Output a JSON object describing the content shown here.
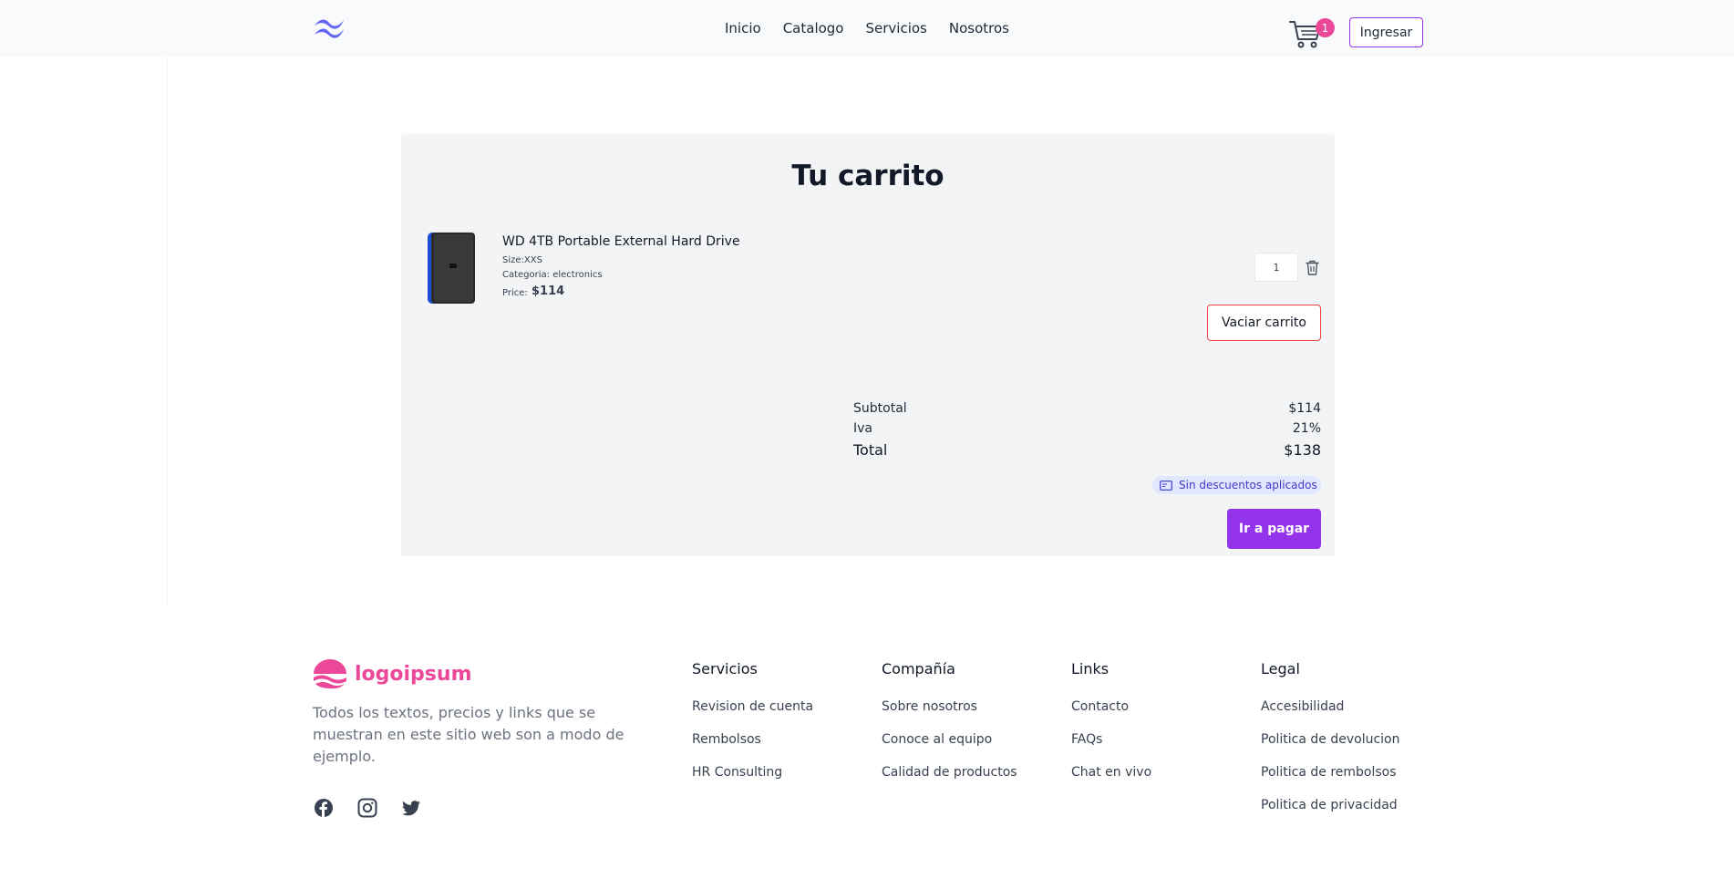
{
  "header": {
    "brand_icon": "tailwind-logo",
    "nav": [
      "Inicio",
      "Catalogo",
      "Servicios",
      "Nosotros"
    ],
    "cart_count": "1",
    "login_label": "Ingresar"
  },
  "cart": {
    "title": "Tu carrito",
    "item": {
      "name": "WD 4TB Portable External Hard Drive",
      "size": "Size:XXS",
      "category": "Categoria: electronics",
      "price_label": "Price:",
      "price": "$114",
      "quantity": "1"
    },
    "empty_label": "Vaciar carrito",
    "summary": {
      "subtotal_label": "Subtotal",
      "subtotal": "$114",
      "iva_label": "Iva",
      "iva": "21%",
      "total_label": "Total",
      "total": "$138"
    },
    "discount_label": "Sin descuentos aplicados",
    "pay_label": "Ir a pagar"
  },
  "footer": {
    "logo_text": "logoipsum",
    "description": "Todos los textos, precios y links que se muestran en este sitio web son a modo de ejemplo.",
    "social": [
      "facebook-icon",
      "instagram-icon",
      "twitter-icon"
    ],
    "columns": [
      {
        "title": "Servicios",
        "links": [
          "Revision de cuenta",
          "Rembolsos",
          "HR Consulting"
        ]
      },
      {
        "title": "Compañía",
        "links": [
          "Sobre nosotros",
          "Conoce al equipo",
          "Calidad de productos"
        ]
      },
      {
        "title": "Links",
        "links": [
          "Contacto",
          "FAQs",
          "Chat en vivo"
        ]
      },
      {
        "title": "Legal",
        "links": [
          "Accesibilidad",
          "Politica de devolucion",
          "Politica de rembolsos",
          "Politica de privacidad"
        ]
      }
    ]
  },
  "colors": {
    "accent": "#9333ea",
    "brand_pink": "#ec4899",
    "danger": "#ef4444"
  }
}
